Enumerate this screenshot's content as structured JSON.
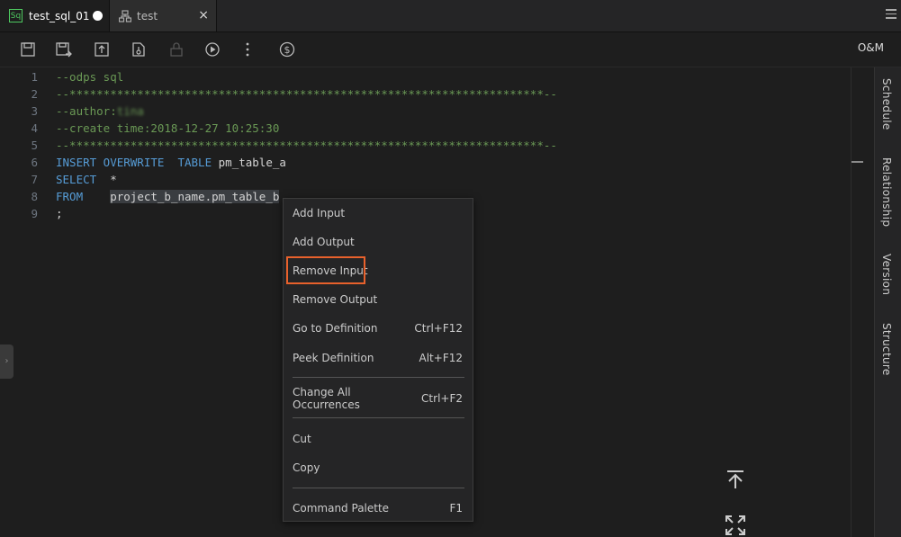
{
  "tabs": [
    {
      "label": "test_sql_01",
      "badge": "Sq",
      "active": true,
      "modified": true
    },
    {
      "label": "test",
      "active": false,
      "close": "×"
    }
  ],
  "toolbar": {
    "icons": [
      "save-icon",
      "save-as-icon",
      "submit-icon",
      "steal-lock-icon",
      "lock-icon",
      "run-icon",
      "more-icon",
      "cost-estimate-icon"
    ],
    "om_label": "O&M"
  },
  "editor": {
    "lines": [
      {
        "num": "1",
        "text": "--odps sql"
      },
      {
        "num": "2",
        "text": "--**********************************************************************--"
      },
      {
        "num": "3",
        "text": "--author:",
        "blurred": "tina"
      },
      {
        "num": "4",
        "text": "--create time:2018-12-27 10:25:30"
      },
      {
        "num": "5",
        "text": "--**********************************************************************--"
      },
      {
        "num": "6",
        "kw1": "INSERT OVERWRITE",
        "kw2": "TABLE",
        "text": "pm_table_a"
      },
      {
        "num": "7",
        "kw1": "SELECT",
        "text": "*"
      },
      {
        "num": "8",
        "kw1": "FROM",
        "text": "project_b_name.pm_table_b"
      },
      {
        "num": "9",
        "text": ";"
      }
    ]
  },
  "right_panel": {
    "tabs": [
      "Schedule",
      "Relationship",
      "Version",
      "Structure"
    ]
  },
  "context_menu": {
    "items": [
      {
        "label": "Add Input",
        "shortcut": ""
      },
      {
        "label": "Add Output",
        "shortcut": ""
      },
      {
        "label": "Remove Input",
        "shortcut": "",
        "highlighted": true
      },
      {
        "label": "Remove Output",
        "shortcut": ""
      },
      {
        "label": "Go to Definition",
        "shortcut": "Ctrl+F12"
      },
      {
        "label": "Peek Definition",
        "shortcut": "Alt+F12"
      },
      {
        "label": "Change All Occurrences",
        "shortcut": "Ctrl+F2"
      },
      {
        "label": "Cut",
        "shortcut": ""
      },
      {
        "label": "Copy",
        "shortcut": ""
      },
      {
        "label": "Command Palette",
        "shortcut": "F1"
      }
    ]
  },
  "colors": {
    "comment": "#6a9955",
    "keyword": "#569cd6",
    "highlight_border": "#e8612c",
    "badge": "#4ec960"
  }
}
